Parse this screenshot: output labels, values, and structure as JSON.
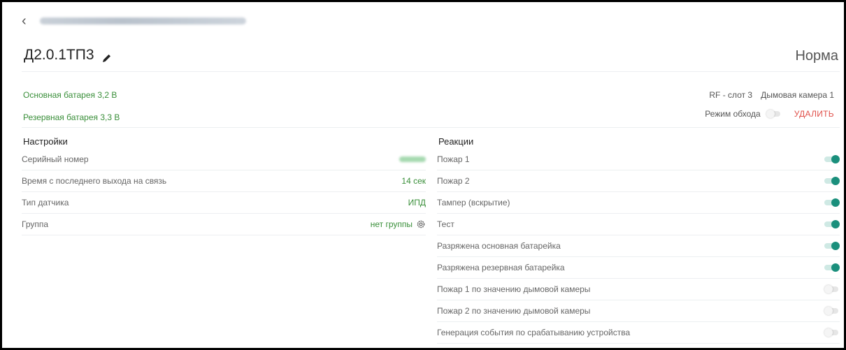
{
  "header": {
    "back_icon": "chevron-left-icon",
    "device_title": "Д2.0.1ТП3",
    "status": "Норма"
  },
  "battery": {
    "main": "Основная батарея 3,2 В",
    "reserve": "Резервная батарея 3,3 В"
  },
  "slot": {
    "rf": "RF - слот 3",
    "camera": "Дымовая камера 1"
  },
  "bypass": {
    "label": "Режим обхода",
    "enabled": false
  },
  "delete_label": "УДАЛИТЬ",
  "settings": {
    "title": "Настройки",
    "rows": [
      {
        "label": "Серийный номер",
        "value": ""
      },
      {
        "label": "Время с последнего выхода на связь",
        "value": "14 сек"
      },
      {
        "label": "Тип датчика",
        "value": "ИПД"
      },
      {
        "label": "Группа",
        "value": "нет группы"
      }
    ]
  },
  "reactions": {
    "title": "Реакции",
    "rows": [
      {
        "label": "Пожар 1",
        "enabled": true
      },
      {
        "label": "Пожар 2",
        "enabled": true
      },
      {
        "label": "Тампер (вскрытие)",
        "enabled": true
      },
      {
        "label": "Тест",
        "enabled": true
      },
      {
        "label": "Разряжена основная батарейка",
        "enabled": true
      },
      {
        "label": "Разряжена резервная батарейка",
        "enabled": true
      },
      {
        "label": "Пожар 1 по значению дымовой камеры",
        "enabled": false
      },
      {
        "label": "Пожар 2 по значению дымовой камеры",
        "enabled": false
      },
      {
        "label": "Генерация события по срабатыванию устройства",
        "enabled": false
      }
    ]
  },
  "colors": {
    "accent_green": "#3a8f3a",
    "toggle_on": "#1a8f7c",
    "delete_red": "#e0504a"
  }
}
